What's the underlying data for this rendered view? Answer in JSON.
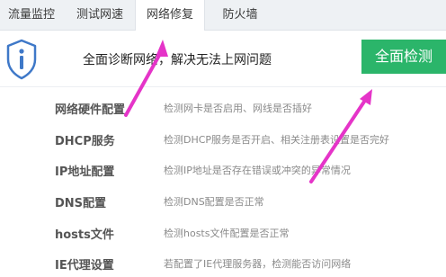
{
  "tabs": [
    {
      "label": "流量监控"
    },
    {
      "label": "测试网速"
    },
    {
      "label": "网络修复"
    },
    {
      "label": "防火墙"
    }
  ],
  "header": {
    "headline": "全面诊断网络，解决无法上网问题",
    "button_label": "全面检测",
    "accent_color": "#2bb56a",
    "icon": "shield-info-icon"
  },
  "items": [
    {
      "name": "网络硬件配置",
      "desc": "检测网卡是否启用、网线是否插好"
    },
    {
      "name": "DHCP服务",
      "desc": "检测DHCP服务是否开启、相关注册表设置是否完好"
    },
    {
      "name": "IP地址配置",
      "desc": "检测IP地址是否存在错误或冲突的异常情况"
    },
    {
      "name": "DNS配置",
      "desc": "检测DNS配置是否正常"
    },
    {
      "name": "hosts文件",
      "desc": "检测hosts文件配置是否正常"
    },
    {
      "name": "IE代理设置",
      "desc": "若配置了IE代理服务器，检测能否访问网络"
    }
  ]
}
